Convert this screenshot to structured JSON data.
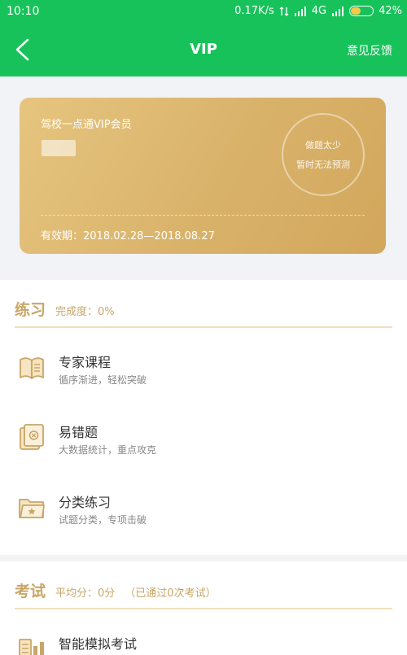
{
  "status_bar": {
    "time": "10:10",
    "speed": "0.17K/s",
    "network": "4G",
    "battery": "42%"
  },
  "nav": {
    "title": "VIP",
    "feedback_label": "意见反馈"
  },
  "vip_card": {
    "title": "驾校一点通VIP会员",
    "ring_line1": "做题太少",
    "ring_line2": "暂时无法预测",
    "validity": "有效期：2018.02.28—2018.08.27"
  },
  "practice": {
    "title": "练习",
    "progress": "完成度：0%",
    "items": [
      {
        "title": "专家课程",
        "desc": "循序渐进，轻松突破",
        "icon": "book-icon"
      },
      {
        "title": "易错题",
        "desc": "大数据统计，重点攻克",
        "icon": "error-card-icon"
      },
      {
        "title": "分类练习",
        "desc": "试题分类，专项击破",
        "icon": "folder-icon"
      }
    ]
  },
  "exam": {
    "title": "考试",
    "average": "平均分：0分",
    "passed": "（已通过0次考试）",
    "items": [
      {
        "title": "智能模拟考试",
        "icon": "exam-bars-icon"
      }
    ]
  },
  "colors": {
    "primary_green": "#18c25a",
    "gold": "#c8a667",
    "card_gold": "#dab46b"
  }
}
